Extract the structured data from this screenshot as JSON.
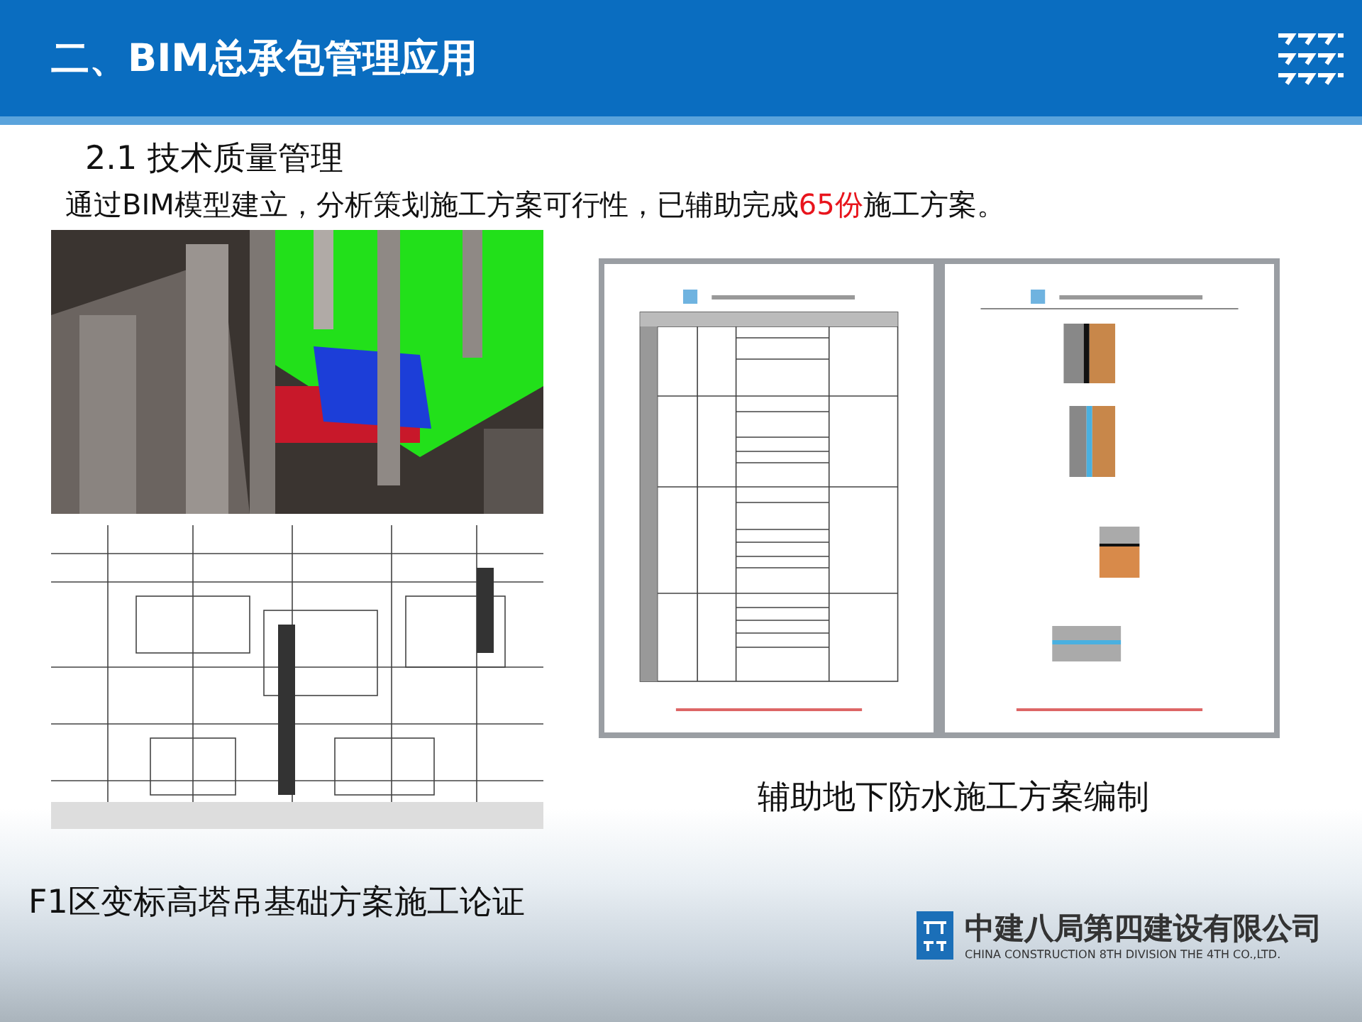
{
  "header": {
    "title": "二、BIM总承包管理应用"
  },
  "section": {
    "heading": "2.1 技术质量管理",
    "intro": [
      {
        "text": "通过BIM模型建立，分析策划施工方案可行性，已辅助完成",
        "highlight": false
      },
      {
        "text": "65份",
        "highlight": true
      },
      {
        "text": "施工方案。",
        "highlight": false
      }
    ]
  },
  "right_caption": "辅助地下防水施工方案编制",
  "left_caption": "F1区变标高塔吊基础方案施工论证",
  "footer": {
    "company": "中建八局第四建设有限公司",
    "company_en": "CHINA CONSTRUCTION 8TH DIVISION THE 4TH CO.,LTD."
  }
}
